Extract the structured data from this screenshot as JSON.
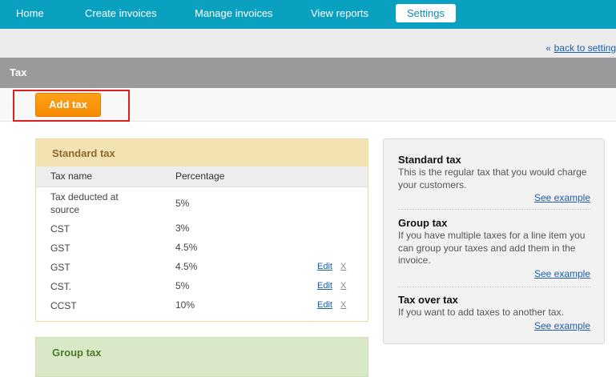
{
  "nav": {
    "items": [
      {
        "label": "Home"
      },
      {
        "label": "Create invoices"
      },
      {
        "label": "Manage invoices"
      },
      {
        "label": "View reports"
      },
      {
        "label": "Settings",
        "active": true
      }
    ]
  },
  "subbar": {
    "back_link": "back to settings"
  },
  "page": {
    "title": "Tax",
    "add_button": "Add tax"
  },
  "standard_tax": {
    "title": "Standard tax",
    "columns": [
      "Tax name",
      "Percentage"
    ],
    "rows": [
      {
        "name": "Tax deducted at source",
        "percentage": "5%",
        "edit": "",
        "delete": ""
      },
      {
        "name": "CST",
        "percentage": "3%",
        "edit": "",
        "delete": ""
      },
      {
        "name": "GST",
        "percentage": "4.5%",
        "edit": "",
        "delete": ""
      },
      {
        "name": "GST",
        "percentage": "4.5%",
        "edit": "Edit",
        "delete": "X"
      },
      {
        "name": "CST.",
        "percentage": "5%",
        "edit": "Edit",
        "delete": "X"
      },
      {
        "name": "CCST",
        "percentage": "10%",
        "edit": "Edit",
        "delete": "X"
      }
    ]
  },
  "group_tax": {
    "title": "Group tax"
  },
  "help": {
    "sections": [
      {
        "title": "Standard tax",
        "text": "This is the regular tax that you would charge your customers.",
        "link": "See example"
      },
      {
        "title": "Group tax",
        "text": "If you have multiple taxes for a line item you can group your taxes and add them in the invoice.",
        "link": "See example"
      },
      {
        "title": "Tax over tax",
        "text": "If you want to add taxes to another tax.",
        "link": "See example"
      }
    ]
  },
  "colors": {
    "nav_bg": "#0aa1c1",
    "title_bar_bg": "#9a9a9a",
    "button_orange": "#f58a00",
    "highlight_red": "#dd1f1f",
    "standard_header": "#f4e3b2",
    "group_header": "#d9e8c6"
  }
}
